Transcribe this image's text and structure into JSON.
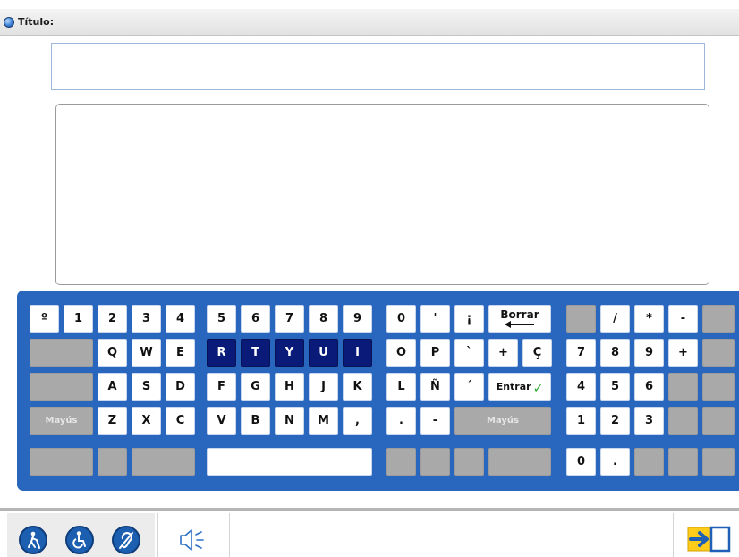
{
  "window": {
    "title": "Título:"
  },
  "form": {
    "title_value": "",
    "body_value": ""
  },
  "keyboard": {
    "row1_left": [
      "º",
      "1",
      "2",
      "3",
      "4"
    ],
    "row1_mid": [
      "5",
      "6",
      "7",
      "8",
      "9"
    ],
    "row1_right": [
      "0",
      "'",
      "¡"
    ],
    "row2_left": [
      "Q",
      "W",
      "E"
    ],
    "row2_mid": [
      "R",
      "T",
      "Y",
      "U",
      "I"
    ],
    "row2_right": [
      "O",
      "P",
      "`",
      "+",
      "Ç"
    ],
    "row3_left": [
      "A",
      "S",
      "D"
    ],
    "row3_mid": [
      "F",
      "G",
      "H",
      "J",
      "K"
    ],
    "row3_right": [
      "L",
      "Ñ",
      "´"
    ],
    "row4_left": [
      "Z",
      "X",
      "C"
    ],
    "row4_mid": [
      "V",
      "B",
      "N",
      "M",
      ","
    ],
    "row4_right": [
      ".",
      "-"
    ],
    "shift_label": "Mayús",
    "backspace_label": "Borrar",
    "enter_label": "Entrar",
    "numpad": {
      "row1": [
        "/",
        "*",
        "-"
      ],
      "row2": [
        "7",
        "8",
        "9",
        "+"
      ],
      "row3": [
        "4",
        "5",
        "6"
      ],
      "row4": [
        "1",
        "2",
        "3"
      ],
      "row5": [
        "0",
        "."
      ]
    },
    "highlight_color": "#0a1a78",
    "accent": "#2867bd"
  },
  "bottom_bar": {
    "icons": [
      "blind-accessibility-icon",
      "wheelchair-accessibility-icon",
      "hearing-accessibility-icon",
      "speaker-icon",
      "exit-icon"
    ]
  }
}
